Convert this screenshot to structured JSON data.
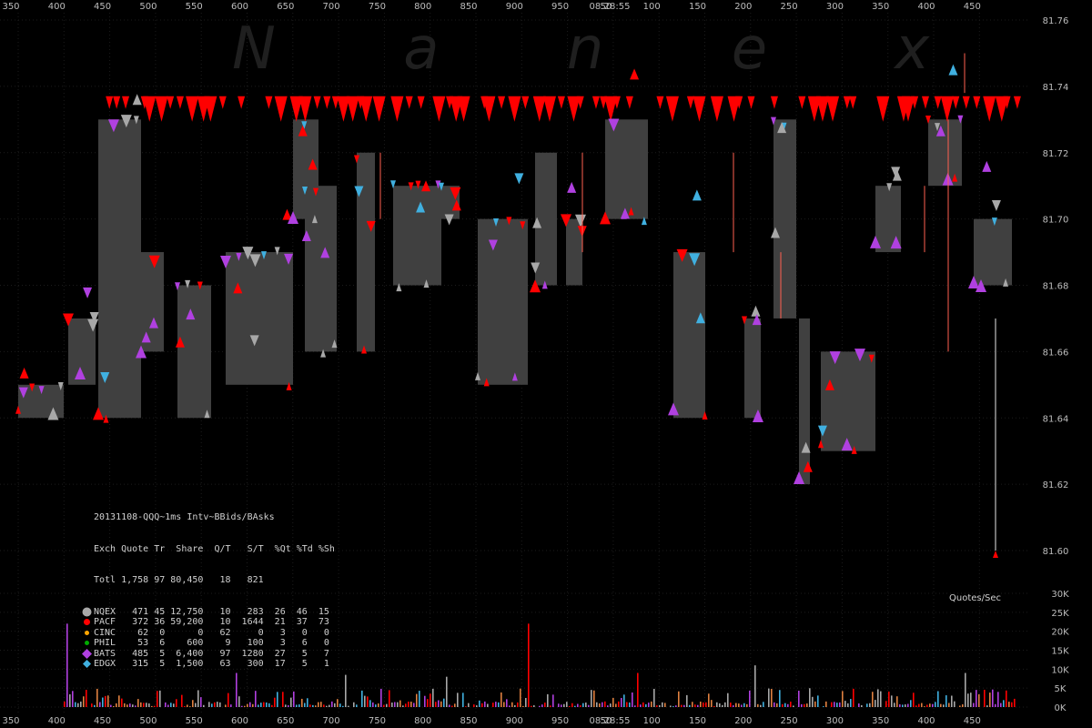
{
  "watermark": "N a n e x",
  "top_time": "08:28:55",
  "bottom_time": "08:28:55",
  "x_ticks_top": [
    "350",
    "400",
    "450",
    "500",
    "550",
    "600",
    "650",
    "700",
    "750",
    "800",
    "850",
    "900",
    "950",
    "50",
    "100",
    "150",
    "200",
    "250",
    "300",
    "350",
    "400",
    "450"
  ],
  "x_ticks_bottom": [
    "350",
    "400",
    "450",
    "500",
    "550",
    "600",
    "650",
    "700",
    "750",
    "800",
    "850",
    "900",
    "950",
    "50",
    "100",
    "150",
    "200",
    "250",
    "300",
    "350",
    "400",
    "450"
  ],
  "price_ticks": [
    "81.76",
    "81.74",
    "81.72",
    "81.70",
    "81.68",
    "81.66",
    "81.64",
    "81.62",
    "81.60"
  ],
  "volume_ticks": [
    "30K",
    "25K",
    "20K",
    "15K",
    "10K",
    "5K",
    "0K"
  ],
  "volume_title": "Quotes/Sec",
  "stats": {
    "title": "20131108-QQQ~1ms Intv~BBids/BAsks",
    "header": "Exch Quote Tr  Share  Q/T   S/T  %Qt %Td %Sh",
    "total": "Totl 1,758 97 80,450   18   821",
    "rows": [
      {
        "icon": "gray-circle-icon",
        "text": "NQEX   471 45 12,750   10   283  26  46  15"
      },
      {
        "icon": "red-circle-icon",
        "text": "PACF   372 36 59,200   10  1644  21  37  73"
      },
      {
        "icon": "orange-circle-icon",
        "text": "CINC    62  0      0   62     0   3   0   0"
      },
      {
        "icon": "green-circle-icon",
        "text": "PHIL    53  6    600    9   100   3   6   0"
      },
      {
        "icon": "purple-diamond-icon",
        "text": "BATS   485  5  6,400   97  1280  27   5   7"
      },
      {
        "icon": "blue-diamond-icon",
        "text": "EDGX   315  5  1,500   63   300  17   5   1"
      }
    ]
  },
  "colors": {
    "background": "#000000",
    "spread_box": "#404040",
    "NQEX": "#a8a8a8",
    "PACF": "#ff0000",
    "CINC": "#ffa500",
    "PHIL": "#00aa00",
    "BATS": "#b040e0",
    "EDGX": "#40b0e0"
  },
  "chart_data": {
    "type": "scatter",
    "title": "20131108-QQQ~1ms Intv~BBids/BAsks",
    "xlabel": "",
    "ylabel": "",
    "ylim": [
      81.59,
      81.76
    ],
    "xlim": [
      0,
      1100
    ],
    "grid": true,
    "legend": "bottom-left",
    "description_series": [
      "NQEX",
      "PACF",
      "CINC",
      "PHIL",
      "BATS",
      "EDGX"
    ],
    "spread_segments": [
      {
        "x0": 20,
        "x1": 70,
        "bid": 81.64,
        "ask": 81.65
      },
      {
        "x0": 75,
        "x1": 105,
        "bid": 81.65,
        "ask": 81.67
      },
      {
        "x0": 108,
        "x1": 155,
        "bid": 81.64,
        "ask": 81.73
      },
      {
        "x0": 155,
        "x1": 180,
        "bid": 81.66,
        "ask": 81.69
      },
      {
        "x0": 195,
        "x1": 232,
        "bid": 81.64,
        "ask": 81.68
      },
      {
        "x0": 248,
        "x1": 290,
        "bid": 81.65,
        "ask": 81.69
      },
      {
        "x0": 290,
        "x1": 322,
        "bid": 81.65,
        "ask": 81.69
      },
      {
        "x0": 322,
        "x1": 350,
        "bid": 81.7,
        "ask": 81.73
      },
      {
        "x0": 335,
        "x1": 370,
        "bid": 81.66,
        "ask": 81.71
      },
      {
        "x0": 392,
        "x1": 412,
        "bid": 81.66,
        "ask": 81.72
      },
      {
        "x0": 432,
        "x1": 485,
        "bid": 81.68,
        "ask": 81.71
      },
      {
        "x0": 485,
        "x1": 505,
        "bid": 81.7,
        "ask": 81.71
      },
      {
        "x0": 525,
        "x1": 580,
        "bid": 81.65,
        "ask": 81.7
      },
      {
        "x0": 588,
        "x1": 612,
        "bid": 81.68,
        "ask": 81.72
      },
      {
        "x0": 622,
        "x1": 640,
        "bid": 81.68,
        "ask": 81.7
      },
      {
        "x0": 665,
        "x1": 712,
        "bid": 81.7,
        "ask": 81.73
      },
      {
        "x0": 740,
        "x1": 775,
        "bid": 81.64,
        "ask": 81.69
      },
      {
        "x0": 818,
        "x1": 836,
        "bid": 81.64,
        "ask": 81.67
      },
      {
        "x0": 850,
        "x1": 875,
        "bid": 81.67,
        "ask": 81.73
      },
      {
        "x0": 878,
        "x1": 890,
        "bid": 81.62,
        "ask": 81.67
      },
      {
        "x0": 902,
        "x1": 962,
        "bid": 81.63,
        "ask": 81.66
      },
      {
        "x0": 962,
        "x1": 990,
        "bid": 81.69,
        "ask": 81.71
      },
      {
        "x0": 1020,
        "x1": 1057,
        "bid": 81.71,
        "ask": 81.73
      },
      {
        "x0": 1070,
        "x1": 1112,
        "bid": 81.68,
        "ask": 81.7
      }
    ],
    "last_trade": {
      "x": 1094,
      "price": 81.6
    },
    "peak_trade": {
      "x": 1060,
      "price": 81.75
    },
    "volume_unit": "quotes per second",
    "volume_max": 30000,
    "volume_peak": 22000
  }
}
